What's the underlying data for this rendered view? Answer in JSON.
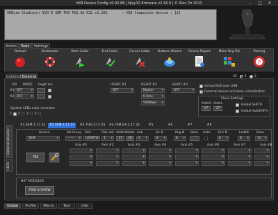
{
  "window": {
    "title": "VKB Device Config v0.92.88 | NJoy32 firmware v2.16.0 | © Alex Oz 2023",
    "min": "–",
    "max": "□",
    "close": "✕"
  },
  "status": {
    "line1": "VKBsim Gladiator EVO R SEM THQ FSS.GA KZ2 v1.16S       : HID Composite device : [2]"
  },
  "main_tabs": [
    "Action",
    "Tools",
    "Settings"
  ],
  "toolbar": {
    "buttons": [
      "Default",
      "Bootloader",
      "Start Calibr",
      "End Calibr",
      "Cancel Calibr",
      "Buttons Wizard",
      "Device Report",
      "Make Reg File",
      "Parking"
    ]
  },
  "sub_tabs": [
    "Common",
    "External"
  ],
  "vc": {
    "label": "VC",
    "opt1": "1",
    "opt2": "2"
  },
  "spi": {
    "label": "SPI",
    "mode_label": "MODE",
    "reg_label": "Reg#",
    "inv_label": "Inv",
    "row1": {
      "num": "#1",
      "mode": "OFF"
    },
    "row2": {
      "num": "#2",
      "mode": "OFF"
    }
  },
  "usart": [
    {
      "label": "USART #1",
      "value": "OFF"
    },
    {
      "label": "USART #2",
      "value": "Master",
      "sub1": "0.5ms",
      "sub2": "500Kbps"
    },
    {
      "label": "USART #3",
      "value": "OFF"
    }
  ],
  "virtual_bus": {
    "label": "Virtual BUS over USB",
    "checked": false
  },
  "ext_encoders": {
    "label": "External device encoders virtualization",
    "checked": true,
    "check_glyph": "✓"
  },
  "slave": {
    "title": "Slave Settings",
    "addr_h": "AddrH",
    "addr_l": "AddrL",
    "addr_h_val": "17",
    "addr_l_val": "17",
    "global_shifts": "Global SHIFTs",
    "global_subshifts": "Global SubSHIFTs"
  },
  "system_leds": {
    "label": "System LEDs color inversion",
    "nums": [
      "1",
      "2",
      "3",
      "4"
    ]
  },
  "sem_tabs": [
    "#1 SEM 2:17.23",
    "#2 SEM 2:17.23",
    "#3 THQ 2:17.24",
    "#4 FSM.GA 2:17.32",
    "#5",
    "#6",
    "#7",
    "#8"
  ],
  "side_tabs": [
    "External devices",
    "LEDs"
  ],
  "sem_cols": {
    "device": "Device",
    "alt_group": "Alt.Group",
    "port": "Port",
    "poll": "Poll, mS",
    "addr_h": "AddrH",
    "addr_l": "AddrL",
    "sub": "Sub",
    "axes": "Ax #",
    "reg": "Reg N",
    "base": "Base",
    "auto": "Auto",
    "enc": "Enc N",
    "leds": "LedsN",
    "base2": "Base"
  },
  "sem_row": {
    "device": "SEM",
    "alt": "------",
    "port": "USART2",
    "poll": "1",
    "addr_h": "17",
    "addr_l": "20",
    "sub": "4",
    "ax": "8",
    "reg": "8",
    "base": "",
    "enc": "8",
    "leds": "8",
    "base2": "12"
  },
  "axes_labels": [
    "Axis #1",
    "Axis #2",
    "Axis #3",
    "Axis #4",
    "Axis #5",
    "Axis #6",
    "Axis #7",
    "Axis #8"
  ],
  "tm_button": "TM",
  "nxt": {
    "title": "NXT MODULES",
    "button": "FIND & SHOW"
  },
  "bottom_tabs": [
    "Global",
    "Profile",
    "Macro",
    "Test",
    "Info"
  ],
  "colors": {
    "accent": "#2d6fd6"
  }
}
